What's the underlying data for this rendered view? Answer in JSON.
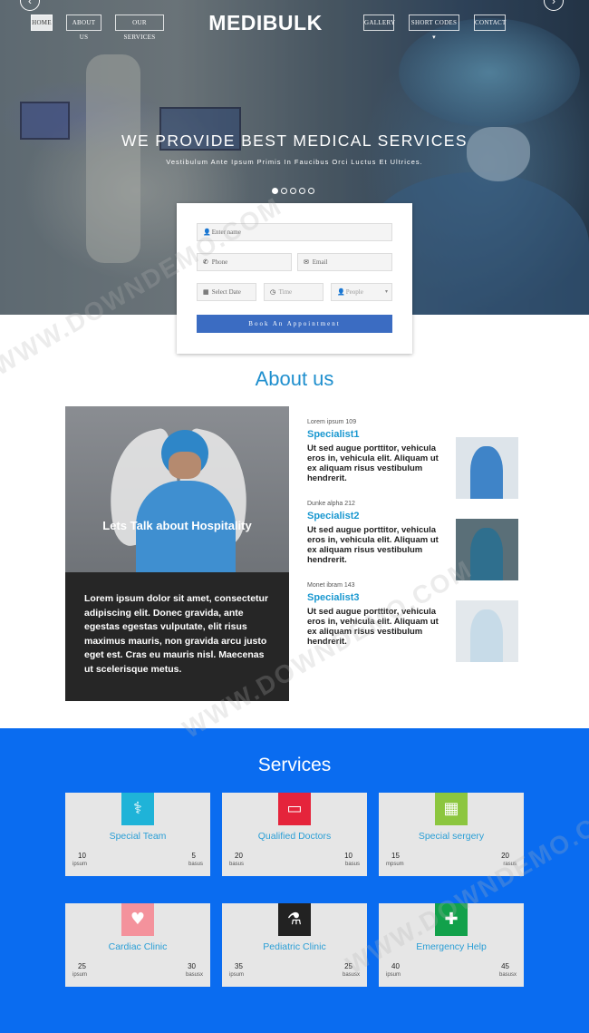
{
  "nav": {
    "home": "HOME",
    "about": "ABOUT US",
    "services": "OUR SERVICES",
    "brand": "MEDIBULK",
    "gallery": "GALLERY",
    "short_codes": "SHORT CODES",
    "contact": "CONTACT"
  },
  "hero": {
    "title": "WE PROVIDE BEST MEDICAL SERVICES",
    "subtitle": "Vestibulum Ante Ipsum Primis In Faucibus Orci Luctus Et Ultrices."
  },
  "booking": {
    "name_placeholder": "Enter name",
    "phone_placeholder": "Phone",
    "email_placeholder": "Email",
    "date_placeholder": "Select Date",
    "time_placeholder": "Time",
    "people_placeholder": "People",
    "button": "Book An Appointment"
  },
  "about": {
    "title": "About us",
    "image_label": "Lets Talk about Hospitality",
    "card_text": "Lorem ipsum dolor sit amet, consectetur adipiscing elit. Donec gravida, ante egestas egestas vulputate, elit risus maximus mauris, non gravida arcu justo eget est. Cras eu mauris nisl. Maecenas ut scelerisque metus.",
    "specialists": [
      {
        "meta": "Lorem ipsum 109",
        "name": "Specialist1",
        "text": "Ut sed augue porttitor, vehicula eros in, vehicula elit. Aliquam ut ex aliquam risus vestibulum hendrerit."
      },
      {
        "meta": "Dunke alpha 212",
        "name": "Specialist2",
        "text": "Ut sed augue porttitor, vehicula eros in, vehicula elit. Aliquam ut ex aliquam risus vestibulum hendrerit."
      },
      {
        "meta": "Monet ibram 143",
        "name": "Specialist3",
        "text": "Ut sed augue porttitor, vehicula eros in, vehicula elit. Aliquam ut ex aliquam risus vestibulum hendrerit."
      }
    ]
  },
  "services": {
    "title": "Services",
    "items": [
      {
        "name": "Special Team",
        "icon": "doctor-team-icon",
        "color": "#1fb3d8",
        "left_num": "10",
        "left_label": "ipsum",
        "right_num": "5",
        "right_label": "basus"
      },
      {
        "name": "Qualified Doctors",
        "icon": "monitor-icon",
        "color": "#e5243b",
        "left_num": "20",
        "left_label": "basus",
        "right_num": "10",
        "right_label": "basus"
      },
      {
        "name": "Special sergery",
        "icon": "hospital-icon",
        "color": "#8cc63f",
        "left_num": "15",
        "left_label": "mpsum",
        "right_num": "20",
        "right_label": "rasus"
      },
      {
        "name": "Cardiac Clinic",
        "icon": "heart-pulse-icon",
        "color": "#f4929c",
        "left_num": "25",
        "left_label": "ipsum",
        "right_num": "30",
        "right_label": "basusx"
      },
      {
        "name": "Pediatric Clinic",
        "icon": "flask-icon",
        "color": "#222222",
        "left_num": "35",
        "left_label": "ipsum",
        "right_num": "25",
        "right_label": "basusx"
      },
      {
        "name": "Emergency Help",
        "icon": "ambulance-icon",
        "color": "#12a14b",
        "left_num": "40",
        "left_label": "ipsum",
        "right_num": "45",
        "right_label": "basusx"
      }
    ]
  },
  "watermark": "WWW.DOWNDEMO.COM"
}
